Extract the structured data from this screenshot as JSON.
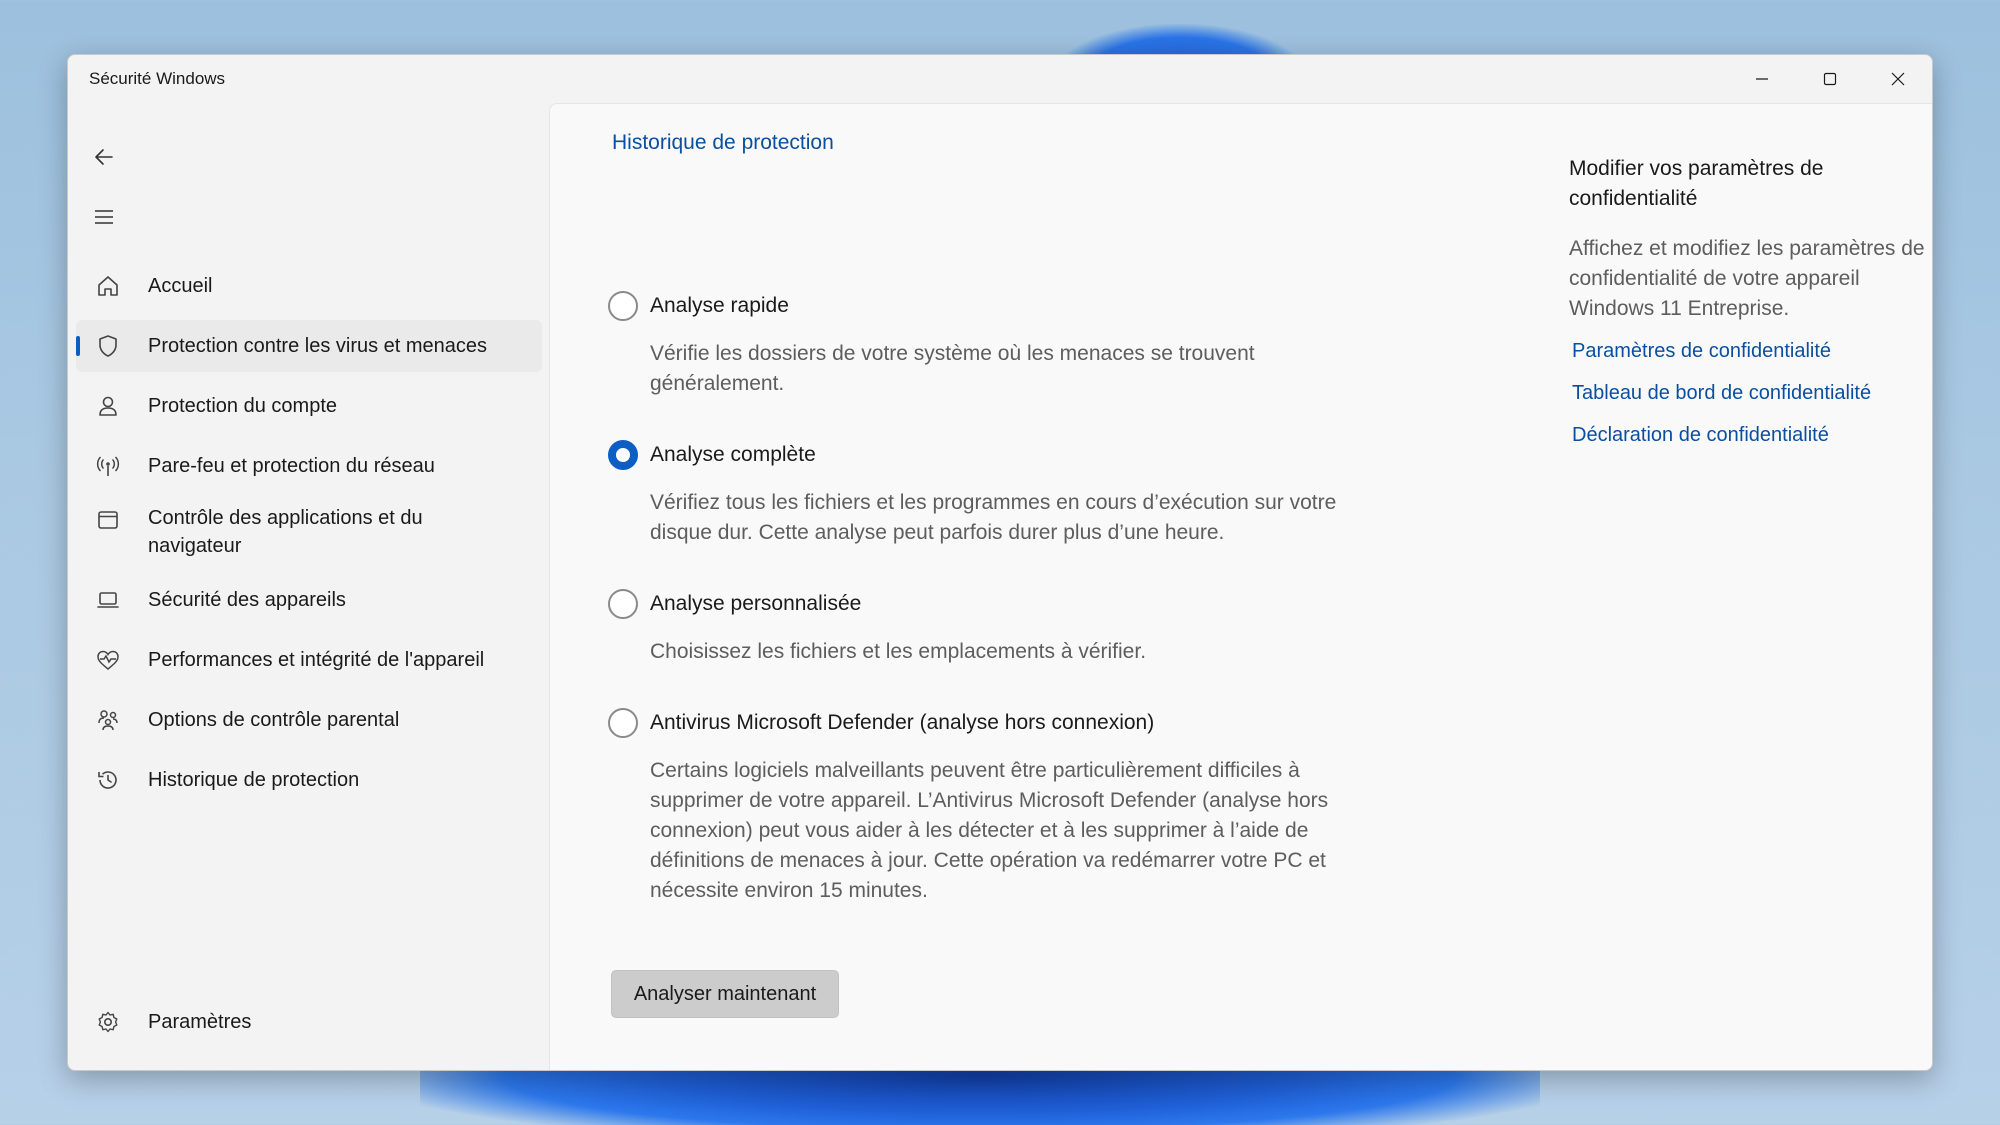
{
  "window": {
    "title": "Sécurité Windows"
  },
  "sidebar": {
    "items": [
      {
        "label": "Accueil",
        "icon": "home-icon"
      },
      {
        "label": "Protection contre les virus et menaces",
        "icon": "shield-icon",
        "selected": true
      },
      {
        "label": "Protection du compte",
        "icon": "person-icon"
      },
      {
        "label": "Pare-feu et protection du réseau",
        "icon": "wifi-antenna-icon"
      },
      {
        "label": "Contrôle des applications et du navigateur",
        "icon": "app-window-icon"
      },
      {
        "label": "Sécurité des appareils",
        "icon": "laptop-icon"
      },
      {
        "label": "Performances et intégrité de l'appareil",
        "icon": "heart-pulse-icon"
      },
      {
        "label": "Options de contrôle parental",
        "icon": "family-icon"
      },
      {
        "label": "Historique de protection",
        "icon": "history-icon"
      }
    ],
    "settings_label": "Paramètres"
  },
  "main": {
    "breadcrumb": "Historique de protection",
    "options": [
      {
        "label": "Analyse rapide",
        "description": "Vérifie les dossiers de votre système où les menaces se trouvent généralement.",
        "checked": false
      },
      {
        "label": "Analyse complète",
        "description": "Vérifiez tous les fichiers et les programmes en cours d’exécution sur votre disque dur. Cette analyse peut parfois durer plus d’une heure.",
        "checked": true
      },
      {
        "label": "Analyse personnalisée",
        "description": "Choisissez les fichiers et les emplacements à vérifier.",
        "checked": false
      },
      {
        "label": "Antivirus Microsoft Defender (analyse hors connexion)",
        "description": "Certains logiciels malveillants peuvent être particulièrement difficiles à supprimer de votre appareil. L’Antivirus Microsoft Defender (analyse hors connexion) peut vous aider à les détecter et à les supprimer à l’aide de définitions de menaces à jour. Cette opération va redémarrer votre PC et nécessite environ 15 minutes.",
        "checked": false
      }
    ],
    "scan_button": "Analyser maintenant"
  },
  "side_panel": {
    "title": "Modifier vos paramètres de confidentialité",
    "description": "Affichez et modifiez les paramètres de confidentialité de votre appareil Windows 11 Entreprise.",
    "links": [
      "Paramètres de confidentialité",
      "Tableau de bord de confidentialité",
      "Déclaration de confidentialité"
    ]
  },
  "colors": {
    "accent": "#0b5fc4",
    "link": "#0a4f9f"
  }
}
